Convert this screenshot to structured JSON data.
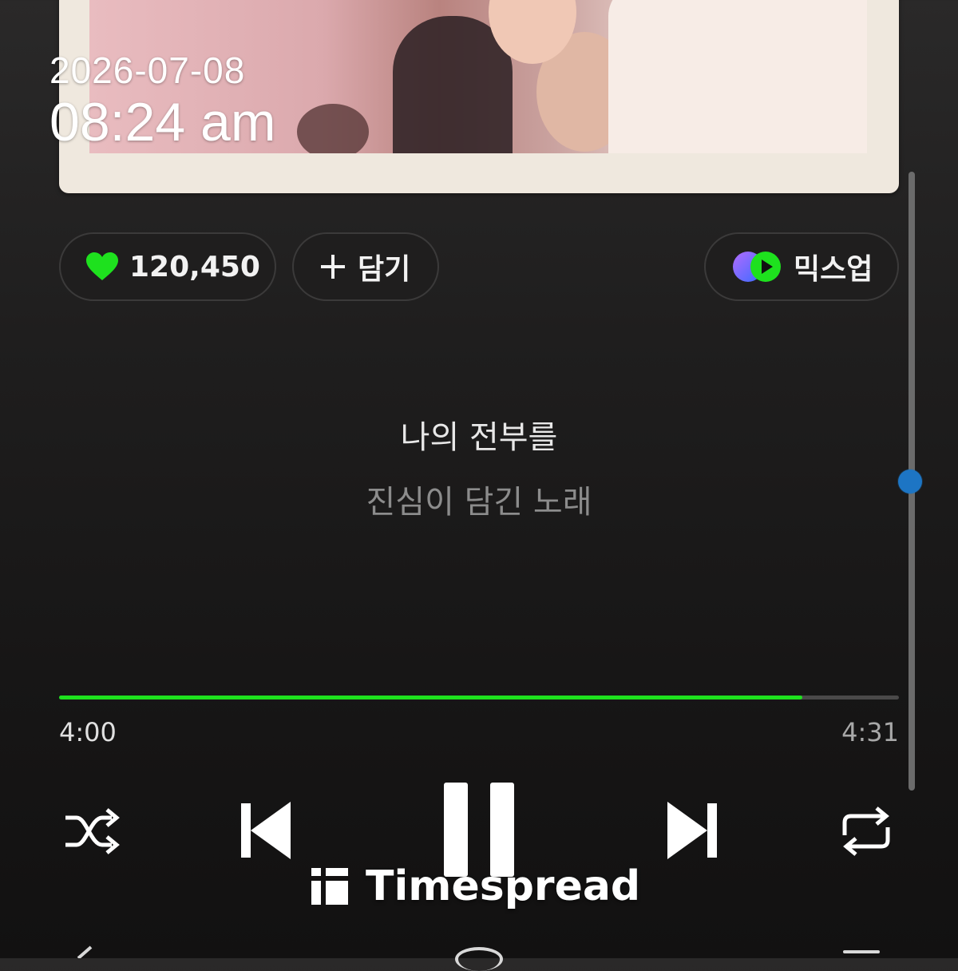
{
  "status": {
    "date": "2026-07-08",
    "time": "08:24 am"
  },
  "actions": {
    "like_count": "120,450",
    "add_label": "담기",
    "mixup_label": "믹스업"
  },
  "lyrics": {
    "current": "나의 전부를",
    "next": "진심이 담긴 노래"
  },
  "player": {
    "elapsed": "4:00",
    "total": "4:31",
    "progress_fraction": 0.885
  },
  "controls": [
    "shuffle-icon",
    "skip-previous-icon",
    "pause-icon",
    "skip-next-icon",
    "repeat-icon"
  ],
  "watermark": {
    "text": "Timespread"
  },
  "colors": {
    "accent_green": "#1ee11e",
    "scroll_thumb": "#1d75c4",
    "background": "#1f1e1e"
  }
}
